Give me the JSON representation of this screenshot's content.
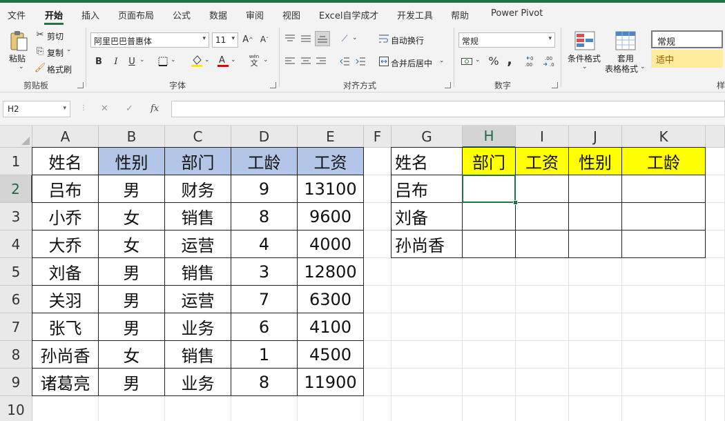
{
  "tabs": [
    "文件",
    "开始",
    "插入",
    "页面布局",
    "公式",
    "数据",
    "审阅",
    "视图",
    "Excel自学成才",
    "开发工具",
    "帮助",
    "Power Pivot"
  ],
  "active_tab": "开始",
  "ribbon": {
    "clipboard": {
      "paste": "粘贴",
      "cut": "剪切",
      "copy": "复制",
      "format_painter": "格式刷",
      "label": "剪贴板"
    },
    "font": {
      "name": "阿里巴巴普惠体",
      "size": "11",
      "bold": "B",
      "italic": "I",
      "underline": "U",
      "grow": "A^",
      "shrink": "Aˇ",
      "label": "字体",
      "phonetic_top": "wén",
      "phonetic_bottom": "文"
    },
    "alignment": {
      "wrap": "自动换行",
      "merge": "合并后居中",
      "label": "对齐方式"
    },
    "number": {
      "format": "常规",
      "label": "数字",
      "percent": "%",
      "comma": ","
    },
    "styles": {
      "conditional": "条件格式",
      "table_line1": "套用",
      "table_line2": "表格格式",
      "normal": "常规",
      "neutral": "适中",
      "label": "样"
    }
  },
  "formula_bar": {
    "name_box": "H2",
    "cancel": "✕",
    "enter": "✓",
    "fx": "fx",
    "formula": ""
  },
  "columns": [
    "A",
    "B",
    "C",
    "D",
    "E",
    "F",
    "G",
    "H",
    "I",
    "J",
    "K"
  ],
  "rows": [
    "1",
    "2",
    "3",
    "4",
    "5",
    "6",
    "7",
    "8",
    "9",
    "10"
  ],
  "active_cell": "H2",
  "table1": {
    "headers": [
      "姓名",
      "性别",
      "部门",
      "工龄",
      "工资"
    ],
    "rows": [
      [
        "吕布",
        "男",
        "财务",
        "9",
        "13100"
      ],
      [
        "小乔",
        "女",
        "销售",
        "8",
        "9600"
      ],
      [
        "大乔",
        "女",
        "运营",
        "4",
        "4000"
      ],
      [
        "刘备",
        "男",
        "销售",
        "3",
        "12800"
      ],
      [
        "关羽",
        "男",
        "运营",
        "7",
        "6300"
      ],
      [
        "张飞",
        "男",
        "业务",
        "6",
        "4100"
      ],
      [
        "孙尚香",
        "女",
        "销售",
        "1",
        "4500"
      ],
      [
        "诸葛亮",
        "男",
        "业务",
        "8",
        "11900"
      ]
    ]
  },
  "table2": {
    "headers": [
      "姓名",
      "部门",
      "工资",
      "性别",
      "工龄"
    ],
    "names": [
      "吕布",
      "刘备",
      "孙尚香"
    ]
  },
  "colors": {
    "accent": "#217346",
    "header_blue": "#b4c6e7",
    "header_yellow": "#ffff00",
    "neutral_style": "#ffeb9c"
  }
}
